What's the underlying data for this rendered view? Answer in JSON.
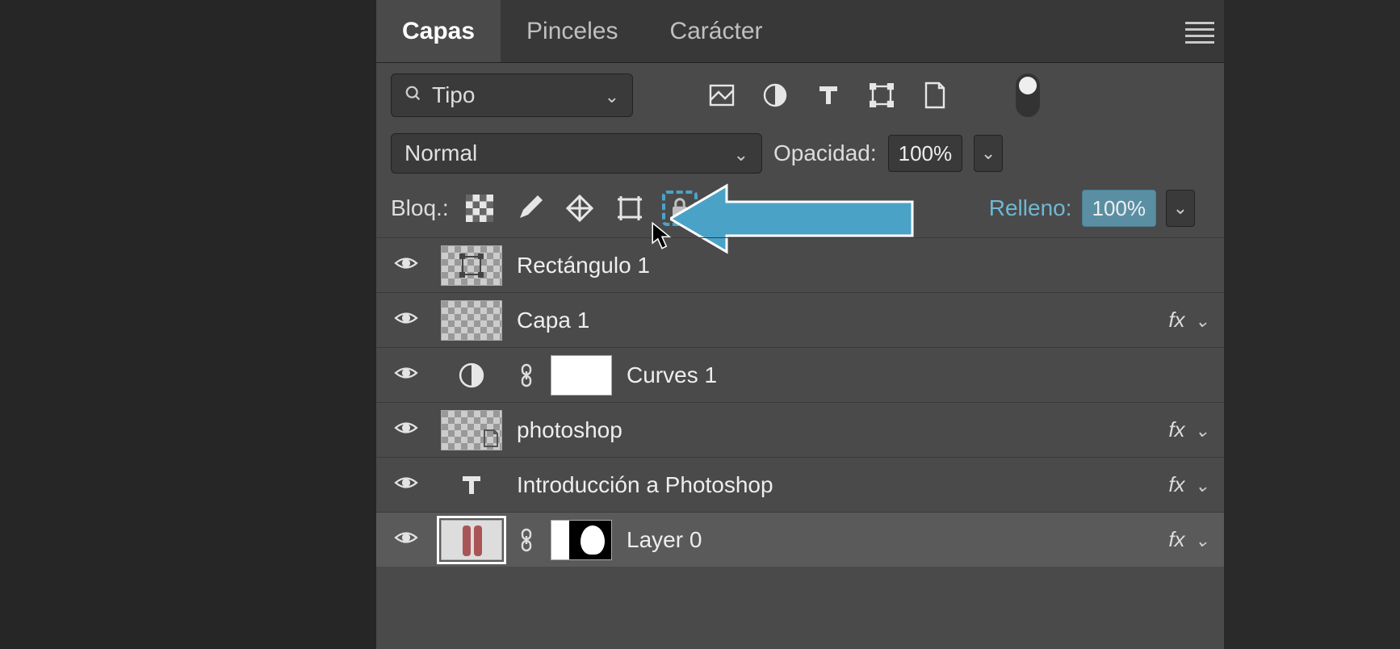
{
  "tabs": {
    "tab1": "Capas",
    "tab2": "Pinceles",
    "tab3": "Carácter"
  },
  "search": {
    "placeholder": "Tipo"
  },
  "blend": {
    "mode": "Normal",
    "opacity_label": "Opacidad:",
    "opacity_value": "100%"
  },
  "lock": {
    "label": "Bloq.:",
    "fill_label": "Relleno:",
    "fill_value": "100%"
  },
  "layers": [
    {
      "name": "Rectángulo 1",
      "fx": false,
      "type": "shape"
    },
    {
      "name": "Capa 1",
      "fx": true,
      "type": "pixel"
    },
    {
      "name": "Curves 1",
      "fx": false,
      "type": "adjustment"
    },
    {
      "name": "photoshop",
      "fx": true,
      "type": "smart"
    },
    {
      "name": "Introducción a Photoshop",
      "fx": true,
      "type": "text"
    },
    {
      "name": "Layer 0",
      "fx": true,
      "type": "masked",
      "selected": true
    }
  ],
  "fx_label": "fx"
}
